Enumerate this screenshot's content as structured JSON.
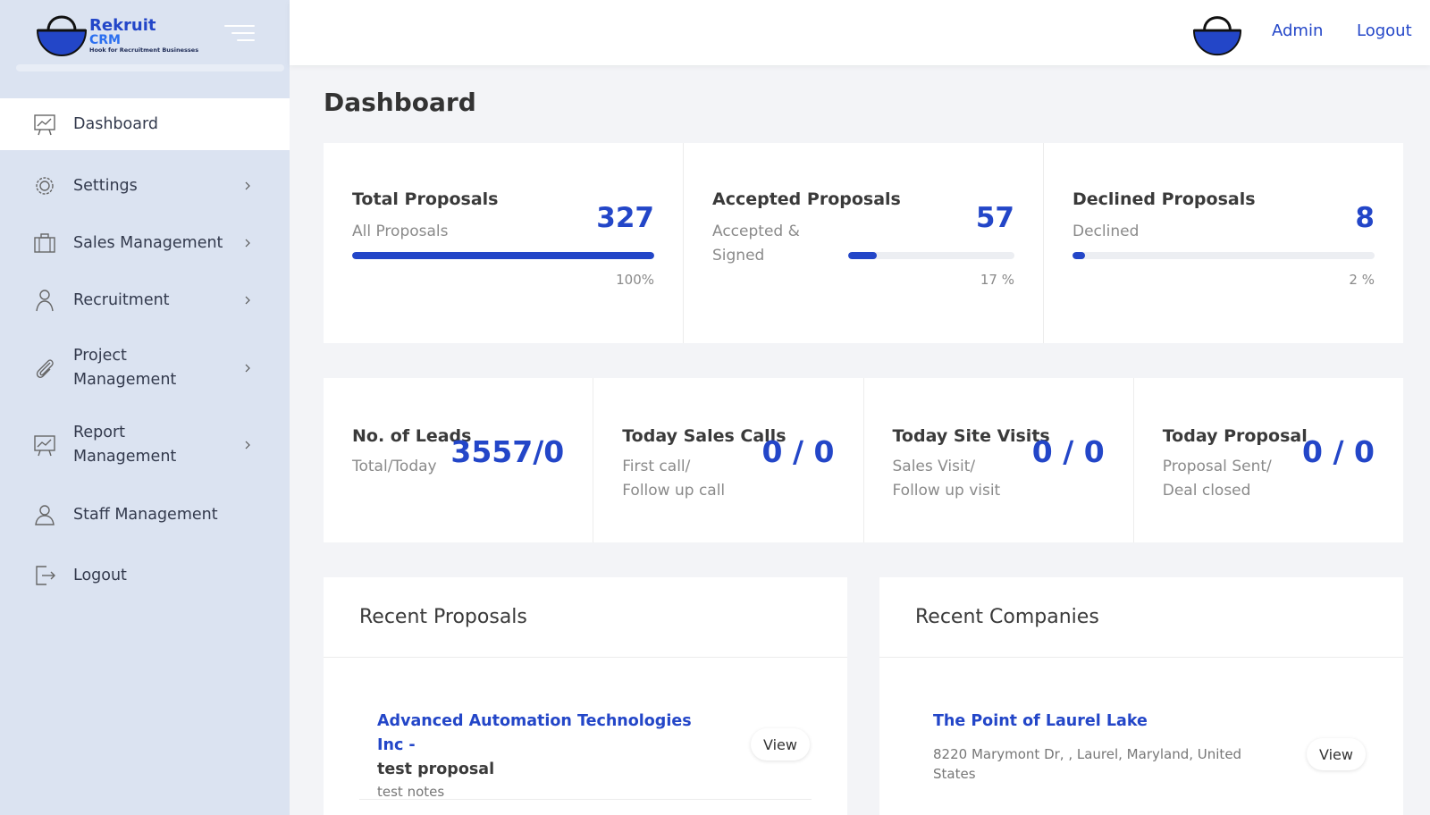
{
  "brand": {
    "name_line1": "Rekruit",
    "name_line2": "CRM",
    "tagline": "Hook for Recruitment Businesses"
  },
  "sidebar": {
    "items": [
      {
        "label": "Dashboard",
        "icon": "chart-board-icon",
        "active": true,
        "has_children": false
      },
      {
        "label": "Settings",
        "icon": "gear-icon",
        "active": false,
        "has_children": true
      },
      {
        "label": "Sales Management",
        "icon": "briefcase-icon",
        "active": false,
        "has_children": true
      },
      {
        "label": "Recruitment",
        "icon": "user-icon",
        "active": false,
        "has_children": true
      },
      {
        "label": "Project Management",
        "icon": "paperclip-icon",
        "active": false,
        "has_children": true
      },
      {
        "label": "Report Management",
        "icon": "chart-board-icon",
        "active": false,
        "has_children": true
      },
      {
        "label": "Staff Management",
        "icon": "users-icon",
        "active": false,
        "has_children": false
      },
      {
        "label": "Logout",
        "icon": "logout-icon",
        "active": false,
        "has_children": false
      }
    ]
  },
  "topbar": {
    "admin_label": "Admin",
    "logout_label": "Logout"
  },
  "page": {
    "title": "Dashboard"
  },
  "proposal_stats": [
    {
      "title": "Total Proposals",
      "subtitle": "All Proposals",
      "value": "327",
      "percent_label": "100%",
      "progress": 1.0
    },
    {
      "title": "Accepted Proposals",
      "subtitle": "Accepted & Signed",
      "value": "57",
      "percent_label": "17 %",
      "progress": 0.17
    },
    {
      "title": "Declined Proposals",
      "subtitle": "Declined",
      "value": "8",
      "percent_label": "2 %",
      "progress": 0.02
    }
  ],
  "lead_stats": [
    {
      "title": "No. of Leads",
      "subtitle_1": "Total/Today",
      "subtitle_2": "",
      "value": "3557/0"
    },
    {
      "title": "Today Sales Calls",
      "subtitle_1": "First call/",
      "subtitle_2": "Follow up call",
      "value": "0 / 0"
    },
    {
      "title": "Today Site Visits",
      "subtitle_1": "Sales Visit/",
      "subtitle_2": "Follow up visit",
      "value": "0 / 0"
    },
    {
      "title": "Today Proposal",
      "subtitle_1": "Proposal Sent/",
      "subtitle_2": "Deal closed",
      "value": "0 / 0"
    }
  ],
  "recent_proposals": {
    "heading": "Recent Proposals",
    "items": [
      {
        "company": "Advanced Automation Technologies Inc -",
        "name": "test proposal",
        "notes": "test notes",
        "action": "View"
      }
    ]
  },
  "recent_companies": {
    "heading": "Recent Companies",
    "items": [
      {
        "name": "The Point of Laurel Lake",
        "address": "8220 Marymont Dr, , Laurel, Maryland, United States",
        "action": "View"
      }
    ]
  },
  "colors": {
    "accent": "#2346c8",
    "sidebar_bg": "#dbe3f1",
    "page_bg": "#f3f4f7"
  }
}
